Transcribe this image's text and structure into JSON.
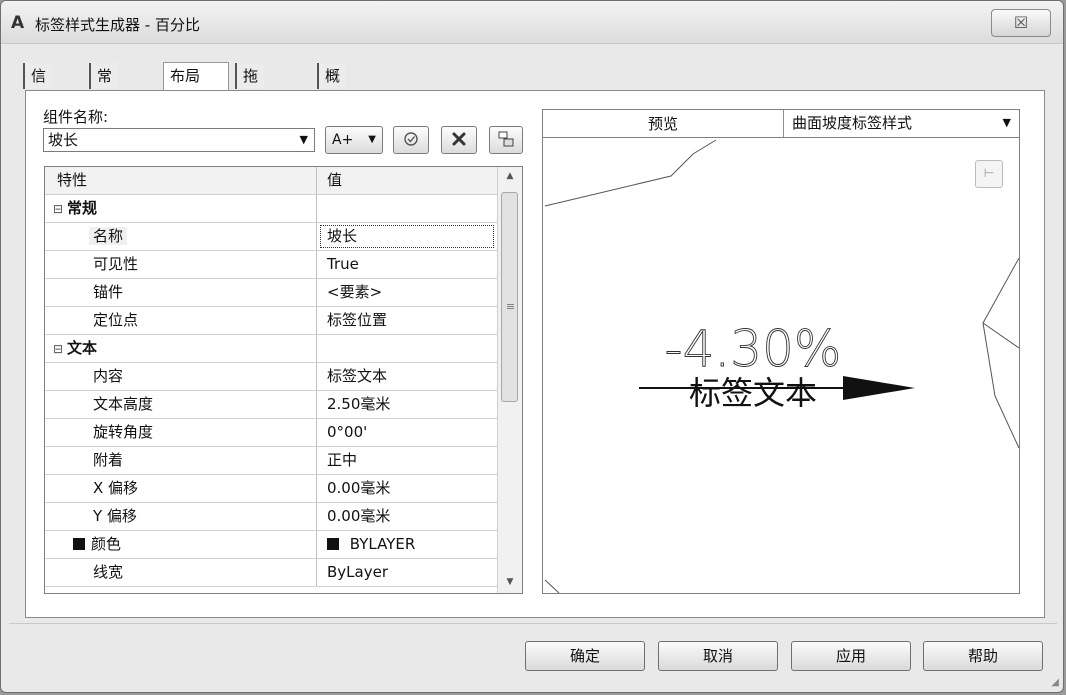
{
  "window": {
    "app_icon": "A",
    "title": "标签样式生成器 - 百分比",
    "close_glyph": "☒"
  },
  "tabs": [
    {
      "label": "信息",
      "active": false
    },
    {
      "label": "常规",
      "active": false
    },
    {
      "label": "布局",
      "active": true
    },
    {
      "label": "拖曳状态",
      "active": false
    },
    {
      "label": "概要",
      "active": false
    }
  ],
  "component": {
    "label": "组件名称:",
    "selected": "坡长",
    "buttons": {
      "add_label": "A+",
      "add_dropdown_glyph": "▼",
      "copy_icon": "copy-component-icon",
      "delete_icon": "delete-component-icon",
      "draw_order_icon": "draw-order-icon"
    }
  },
  "grid": {
    "headers": {
      "property": "特性",
      "value": "值"
    },
    "rows": [
      {
        "type": "group",
        "name": "常规",
        "expander": "⊟"
      },
      {
        "type": "item",
        "name": "名称",
        "value": "坡长",
        "selected": true
      },
      {
        "type": "item",
        "name": "可见性",
        "value": "True"
      },
      {
        "type": "item",
        "name": "锚件",
        "value": "<要素>"
      },
      {
        "type": "item",
        "name": "定位点",
        "value": "标签位置"
      },
      {
        "type": "group",
        "name": "文本",
        "expander": "⊟"
      },
      {
        "type": "item",
        "name": "内容",
        "value": "标签文本"
      },
      {
        "type": "item",
        "name": "文本高度",
        "value": "2.50毫米"
      },
      {
        "type": "item",
        "name": "旋转角度",
        "value": "0°00'"
      },
      {
        "type": "item",
        "name": "附着",
        "value": "正中"
      },
      {
        "type": "item",
        "name": "X 偏移",
        "value": "0.00毫米"
      },
      {
        "type": "item",
        "name": "Y 偏移",
        "value": "0.00毫米"
      },
      {
        "type": "item",
        "name": "颜色",
        "value": "BYLAYER",
        "swatch": "#111111"
      },
      {
        "type": "item",
        "name": "线宽",
        "value": "ByLayer"
      }
    ]
  },
  "preview": {
    "label": "预览",
    "style_selected": "曲面坡度标签样式",
    "sample_value": "-4.30%",
    "sample_text": "标签文本"
  },
  "buttons": {
    "ok": "确定",
    "cancel": "取消",
    "apply": "应用",
    "help": "帮助"
  }
}
